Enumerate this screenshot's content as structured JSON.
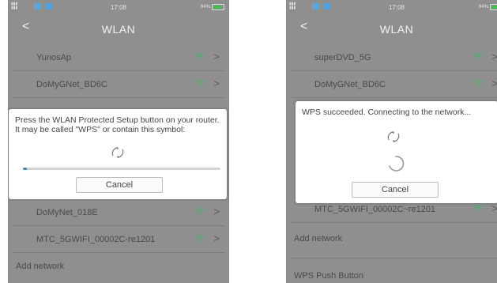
{
  "phones": [
    {
      "status": {
        "time": "17:08",
        "battery": "64%"
      },
      "title": "WLAN",
      "networks_top": [
        {
          "name": "YunosAp"
        },
        {
          "name": "DoMyGNet_BD6C"
        }
      ],
      "networks_bottom": [
        {
          "name": "DoMyNet_018E"
        },
        {
          "name": "MTC_5GWIFI_00002C-re1201"
        }
      ],
      "add_network": "Add network",
      "dialog": {
        "message": "Press the WLAN Protected Setup button on your router. It may be called \"WPS\" or contain this symbol:",
        "progress": 0.02,
        "cancel": "Cancel"
      }
    },
    {
      "status": {
        "time": "17:08",
        "battery": "64%"
      },
      "title": "WLAN",
      "networks_top": [
        {
          "name": "superDVD_5G"
        },
        {
          "name": "DoMyGNet_BD6C"
        }
      ],
      "networks_bottom": [
        {
          "name": "MTC_5GWIFI_00002C~re1201"
        }
      ],
      "add_network": "Add network",
      "wps_push_button": "WPS Push Button",
      "dialog": {
        "message": "WPS succeeded. Connecting to the network...",
        "cancel": "Cancel"
      }
    }
  ],
  "colors": {
    "overlay": "#8f8f8f",
    "wifi": "#49b36a",
    "progress": "#3a86d4",
    "battery": "#3ec14a"
  },
  "icons": [
    "back-arrow-icon",
    "wifi-icon",
    "chevron-right-icon",
    "wps-icon",
    "spinner-icon"
  ]
}
